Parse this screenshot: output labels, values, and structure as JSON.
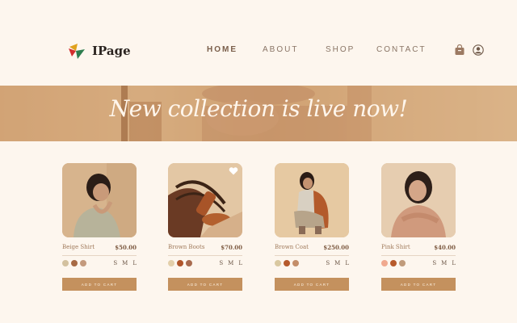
{
  "brand": {
    "name": "IPage",
    "logo_icon": "tricolor-leaf-logo",
    "colors": [
      "#e0a11d",
      "#d32f2f",
      "#2e7d4f"
    ]
  },
  "nav": {
    "items": [
      {
        "label": "HOME",
        "active": true
      },
      {
        "label": "ABOUT",
        "active": false
      },
      {
        "label": "SHOP",
        "active": false
      },
      {
        "label": "CONTACT",
        "active": false
      }
    ],
    "icons": [
      "shopping-bag-icon",
      "user-icon"
    ]
  },
  "banner": {
    "headline": "New collection is live now!"
  },
  "theme": {
    "background": "#fdf6ee",
    "accent": "#c4915e",
    "banner": "#d2a274"
  },
  "products": [
    {
      "name": "Beige Shirt",
      "price": "$50.00",
      "swatches": [
        "#d3c19f",
        "#a76a44",
        "#c49a7d"
      ],
      "sizes": [
        "S",
        "M",
        "L"
      ],
      "button": "ADD TO CART",
      "favorited": false
    },
    {
      "name": "Brown Boots",
      "price": "$70.00",
      "swatches": [
        "#e3cfaa",
        "#b0552a",
        "#a86b4f"
      ],
      "sizes": [
        "S",
        "M",
        "L"
      ],
      "button": "ADD TO CART",
      "favorited": true
    },
    {
      "name": "Brown Coat",
      "price": "$250.00",
      "swatches": [
        "#d9c8a0",
        "#b65a2c",
        "#c48e69"
      ],
      "sizes": [
        "S",
        "M",
        "L"
      ],
      "button": "ADD TO CART",
      "favorited": false
    },
    {
      "name": "Pink Shirt",
      "price": "$40.00",
      "swatches": [
        "#f0a98f",
        "#b75a2b",
        "#c09b7b"
      ],
      "sizes": [
        "S",
        "M",
        "L"
      ],
      "button": "ADD TO CART",
      "favorited": false
    }
  ]
}
